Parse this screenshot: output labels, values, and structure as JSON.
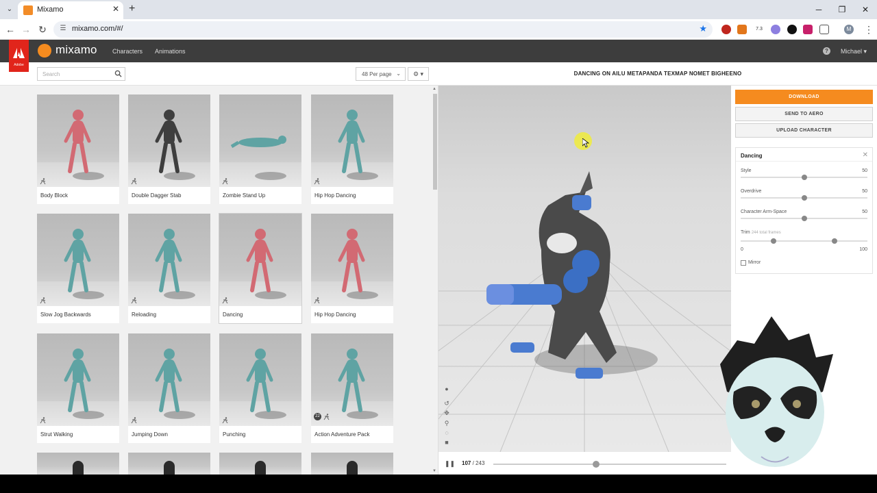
{
  "browser": {
    "tab_title": "Mixamo",
    "url": "mixamo.com/#/",
    "ext_badge": "7.3",
    "profile_initial": "M"
  },
  "app": {
    "brand": "mixamo",
    "adobe_label": "Adobe",
    "nav": [
      "Characters",
      "Animations"
    ],
    "user": "Michael"
  },
  "search": {
    "placeholder": "Search"
  },
  "per_page": "48 Per page",
  "grid": [
    {
      "label": "Body Block",
      "color": "#d26a73"
    },
    {
      "label": "Double Dagger Stab",
      "color": "#3e3e3e"
    },
    {
      "label": "Zombie Stand Up",
      "color": "#5fa3a3"
    },
    {
      "label": "Hip Hop Dancing",
      "color": "#5fa3a3"
    },
    {
      "label": "Slow Jog Backwards",
      "color": "#5fa3a3"
    },
    {
      "label": "Reloading",
      "color": "#5fa3a3"
    },
    {
      "label": "Dancing",
      "color": "#d26a73"
    },
    {
      "label": "Hip Hop Dancing",
      "color": "#d26a73"
    },
    {
      "label": "Strut Walking",
      "color": "#5fa3a3"
    },
    {
      "label": "Jumping Down",
      "color": "#5fa3a3"
    },
    {
      "label": "Punching",
      "color": "#5fa3a3"
    },
    {
      "label": "Action Adventure Pack",
      "color": "#5fa3a3",
      "badge": "22"
    }
  ],
  "viewer": {
    "title": "DANCING ON AILU METAPANDA TEXMAP NOMET BIGHEENO",
    "frame_current": "107",
    "frame_total": "/ 243",
    "progress": 0.44
  },
  "actions": {
    "download": "DOWNLOAD",
    "send": "SEND TO AERO",
    "upload": "UPLOAD CHARACTER"
  },
  "props": {
    "title": "Dancing",
    "sliders": [
      {
        "label": "Style",
        "value": "50",
        "pos": 0.5
      },
      {
        "label": "Overdrive",
        "value": "50",
        "pos": 0.5
      },
      {
        "label": "Character Arm-Space",
        "value": "50",
        "pos": 0.5
      }
    ],
    "trim_label": "Trim",
    "trim_note": "244 total frames",
    "trim_min": "0",
    "trim_max": "100",
    "trim_start": 0.26,
    "trim_end": 0.74,
    "mirror": "Mirror"
  }
}
